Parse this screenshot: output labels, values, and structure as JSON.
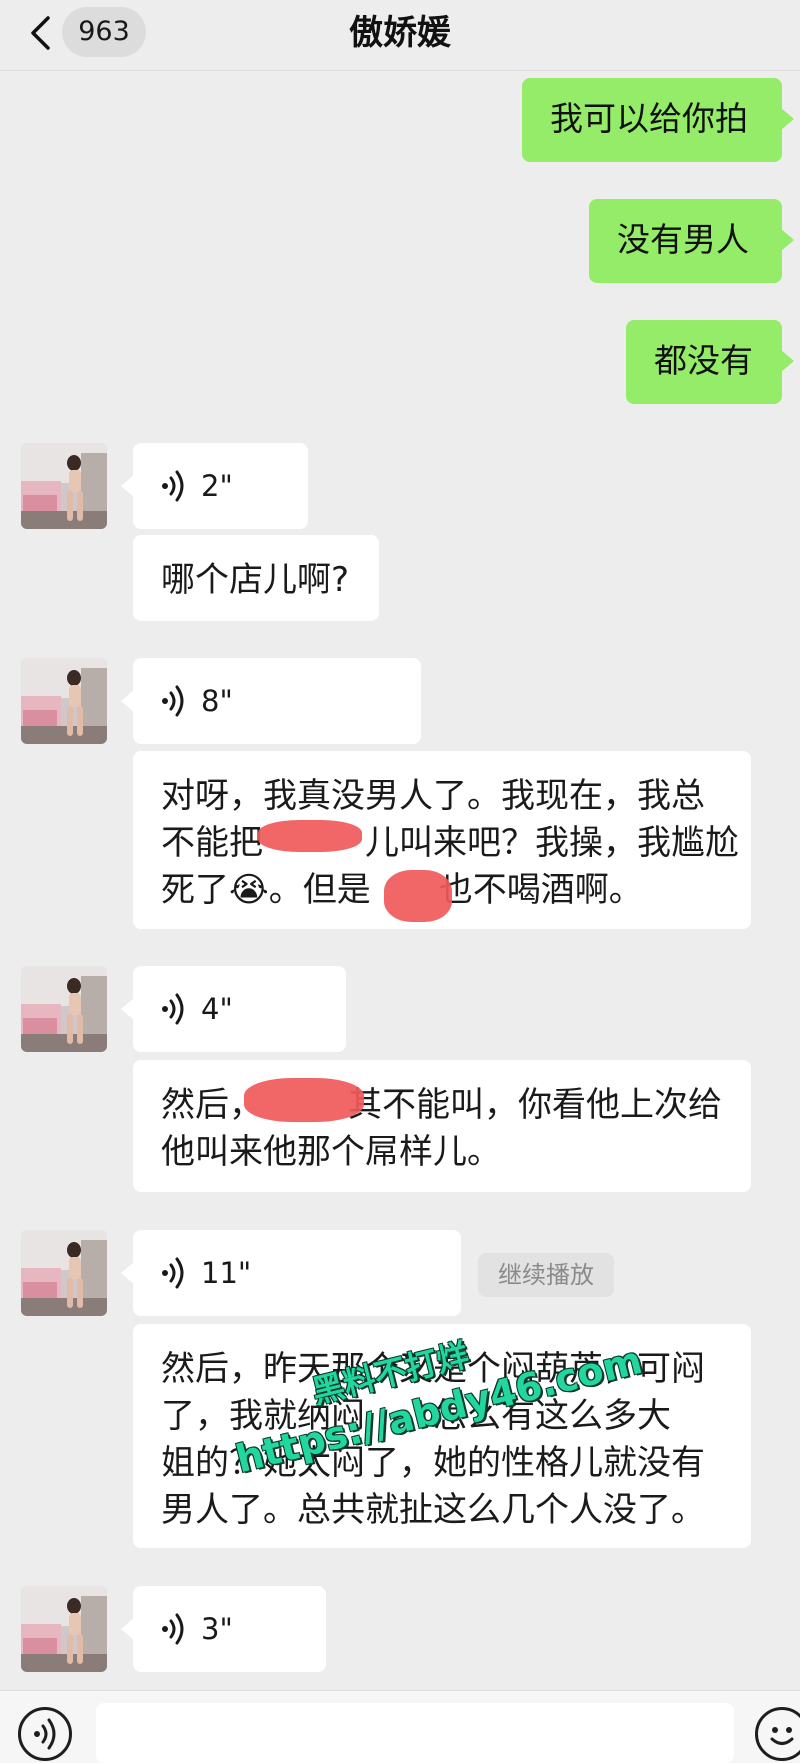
{
  "header": {
    "back_icon": "chevron-left-icon",
    "unread_count": "963",
    "title": "傲娇媛"
  },
  "sent_messages": [
    "我可以给你拍",
    "没有男人",
    "都没有"
  ],
  "received": [
    {
      "voice_duration": "2\"",
      "text_lines": [
        "哪个店儿啊?"
      ]
    },
    {
      "voice_duration": "8\"",
      "text_lines": [
        "对呀，我真没男人了。我现在，我总",
        "不能把　　　儿叫来吧？我操，我尴尬",
        "死了😭。但是　　也不喝酒啊。"
      ]
    },
    {
      "voice_duration": "4\"",
      "text_lines": [
        "然后，　　　其不能叫，你看他上次给",
        "他叫来他那个屌样儿。"
      ]
    },
    {
      "voice_duration": "11\"",
      "continue_label": "继续播放",
      "text_lines": [
        "然后，昨天那个又是个闷葫芦，可闷",
        "了，我就纳闷　　怎么有这么多大",
        "姐的？她太闷了，她的性格儿就没有",
        "男人了。总共就扯这么几个人没了。"
      ]
    },
    {
      "voice_duration": "3\""
    }
  ],
  "watermark": {
    "line1": "黑料不打烊",
    "line2": "https://abdy46.com"
  },
  "colors": {
    "background": "#ededed",
    "sent_bubble": "#95ec69",
    "received_bubble": "#ffffff",
    "redaction": "#f05a5a",
    "watermark": "#22d6a0"
  },
  "footer": {
    "voice_icon": "voice-input-icon",
    "emoji_icon": "emoji-icon"
  }
}
